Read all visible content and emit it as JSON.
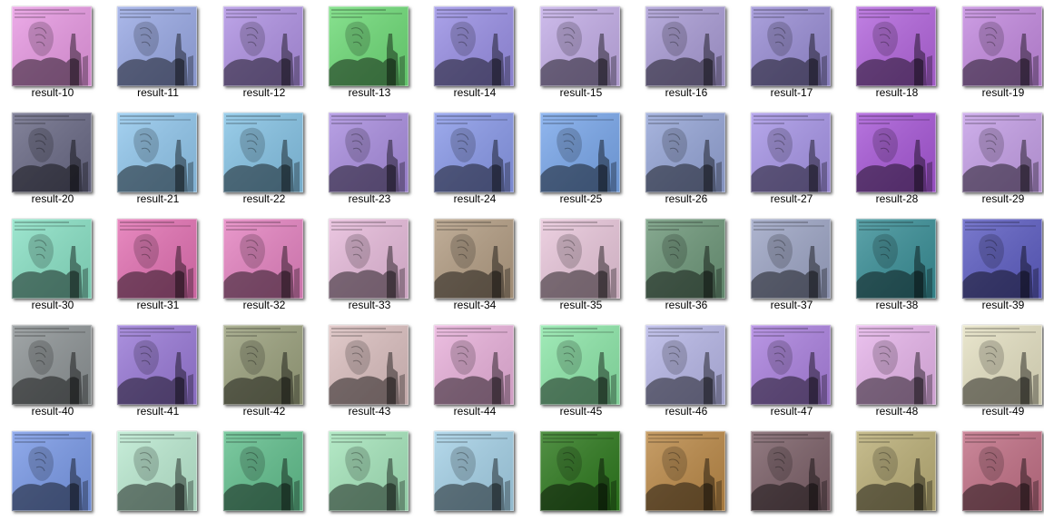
{
  "window": {
    "view": "large-icons"
  },
  "items": [
    {
      "label": "result-10",
      "color": "#e99ae4",
      "icon": "image-thumbnail-icon"
    },
    {
      "label": "result-11",
      "color": "#9aaae6",
      "icon": "image-thumbnail-icon"
    },
    {
      "label": "result-12",
      "color": "#b092e4",
      "icon": "image-thumbnail-icon"
    },
    {
      "label": "result-13",
      "color": "#6fdc78",
      "icon": "image-thumbnail-icon"
    },
    {
      "label": "result-14",
      "color": "#9a90e6",
      "icon": "image-thumbnail-icon"
    },
    {
      "label": "result-15",
      "color": "#c4aee8",
      "icon": "image-thumbnail-icon"
    },
    {
      "label": "result-16",
      "color": "#aa9cd6",
      "icon": "image-thumbnail-icon"
    },
    {
      "label": "result-17",
      "color": "#9a8ed6",
      "icon": "image-thumbnail-icon"
    },
    {
      "label": "result-18",
      "color": "#b466de",
      "icon": "image-thumbnail-icon"
    },
    {
      "label": "result-19",
      "color": "#c48ae0",
      "icon": "image-thumbnail-icon"
    },
    {
      "label": "result-20",
      "color": "#6a6a86",
      "icon": "image-thumbnail-icon"
    },
    {
      "label": "result-21",
      "color": "#92c8ee",
      "icon": "image-thumbnail-icon"
    },
    {
      "label": "result-22",
      "color": "#86c4e6",
      "icon": "image-thumbnail-icon"
    },
    {
      "label": "result-23",
      "color": "#aa8ee0",
      "icon": "image-thumbnail-icon"
    },
    {
      "label": "result-24",
      "color": "#8a9aea",
      "icon": "image-thumbnail-icon"
    },
    {
      "label": "result-25",
      "color": "#7aa8ec",
      "icon": "image-thumbnail-icon"
    },
    {
      "label": "result-26",
      "color": "#96a6d8",
      "icon": "image-thumbnail-icon"
    },
    {
      "label": "result-27",
      "color": "#a896e8",
      "icon": "image-thumbnail-icon"
    },
    {
      "label": "result-28",
      "color": "#a858d8",
      "icon": "image-thumbnail-icon"
    },
    {
      "label": "result-29",
      "color": "#c6a0e8",
      "icon": "image-thumbnail-icon"
    },
    {
      "label": "result-30",
      "color": "#8ae2c6",
      "icon": "image-thumbnail-icon"
    },
    {
      "label": "result-31",
      "color": "#e472b4",
      "icon": "image-thumbnail-icon"
    },
    {
      "label": "result-32",
      "color": "#e684c2",
      "icon": "image-thumbnail-icon"
    },
    {
      "label": "result-33",
      "color": "#e8bcdc",
      "icon": "image-thumbnail-icon"
    },
    {
      "label": "result-34",
      "color": "#b49e84",
      "icon": "image-thumbnail-icon"
    },
    {
      "label": "result-35",
      "color": "#eac8dc",
      "icon": "image-thumbnail-icon"
    },
    {
      "label": "result-36",
      "color": "#6e987a",
      "icon": "image-thumbnail-icon"
    },
    {
      "label": "result-37",
      "color": "#9ea6c6",
      "icon": "image-thumbnail-icon"
    },
    {
      "label": "result-38",
      "color": "#3a9098",
      "icon": "image-thumbnail-icon"
    },
    {
      "label": "result-39",
      "color": "#5e5ec4",
      "icon": "image-thumbnail-icon"
    },
    {
      "label": "result-40",
      "color": "#8e9496",
      "icon": "image-thumbnail-icon"
    },
    {
      "label": "result-41",
      "color": "#9a7ad8",
      "icon": "image-thumbnail-icon"
    },
    {
      "label": "result-42",
      "color": "#9ca27e",
      "icon": "image-thumbnail-icon"
    },
    {
      "label": "result-43",
      "color": "#dcc0c0",
      "icon": "image-thumbnail-icon"
    },
    {
      "label": "result-44",
      "color": "#eab2dc",
      "icon": "image-thumbnail-icon"
    },
    {
      "label": "result-45",
      "color": "#8ee8aa",
      "icon": "image-thumbnail-icon"
    },
    {
      "label": "result-46",
      "color": "#b8b8e8",
      "icon": "image-thumbnail-icon"
    },
    {
      "label": "result-47",
      "color": "#ac82e0",
      "icon": "image-thumbnail-icon"
    },
    {
      "label": "result-48",
      "color": "#e8b6ec",
      "icon": "image-thumbnail-icon"
    },
    {
      "label": "result-49",
      "color": "#e6e2c4",
      "icon": "image-thumbnail-icon"
    },
    {
      "label": "",
      "color": "#7a9ae8",
      "icon": "image-thumbnail-icon"
    },
    {
      "label": "",
      "color": "#bcebd2",
      "icon": "image-thumbnail-icon"
    },
    {
      "label": "",
      "color": "#62c08e",
      "icon": "image-thumbnail-icon"
    },
    {
      "label": "",
      "color": "#a6e6bc",
      "icon": "image-thumbnail-icon"
    },
    {
      "label": "",
      "color": "#a6d2e8",
      "icon": "image-thumbnail-icon"
    },
    {
      "label": "",
      "color": "#2e7a1e",
      "icon": "image-thumbnail-icon"
    },
    {
      "label": "",
      "color": "#bc8a48",
      "icon": "image-thumbnail-icon"
    },
    {
      "label": "",
      "color": "#7c6068",
      "icon": "image-thumbnail-icon"
    },
    {
      "label": "",
      "color": "#bcb078",
      "icon": "image-thumbnail-icon"
    },
    {
      "label": "",
      "color": "#c27086",
      "icon": "image-thumbnail-icon"
    }
  ]
}
